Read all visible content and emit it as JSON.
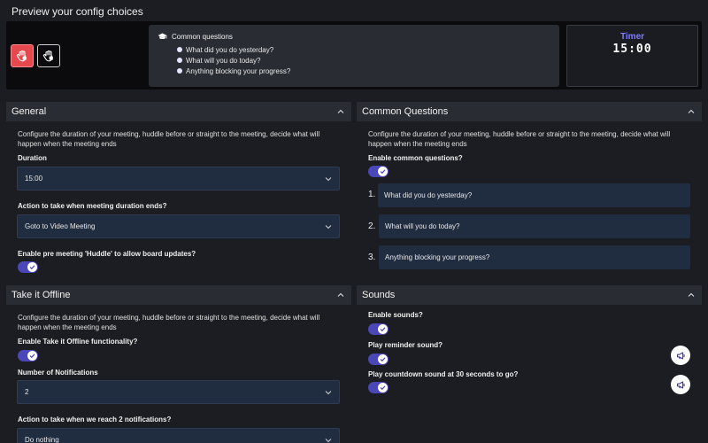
{
  "page_title": "Preview your config choices",
  "preview": {
    "common_questions_title": "Common questions",
    "questions": [
      "What did you do yesterday?",
      "What will you do today?",
      "Anything blocking your progress?"
    ],
    "timer_label": "Timer",
    "timer_value": "15:00"
  },
  "general": {
    "title": "General",
    "description": "Configure the duration of your meeting, huddle before or straight to the meeting, decide what will happen when the meeting ends",
    "duration_label": "Duration",
    "duration_value": "15:00",
    "action_label": "Action to take when meeting duration ends?",
    "action_value": "Goto to Video Meeting",
    "huddle_label": "Enable pre meeting 'Huddle' to allow board updates?",
    "huddle_enabled": true
  },
  "common_questions": {
    "title": "Common Questions",
    "description": "Configure the duration of your meeting, huddle before or straight to the meeting, decide what will happen when the meeting ends",
    "enable_label": "Enable common questions?",
    "enabled": true,
    "items": [
      {
        "num": "1.",
        "text": "What did you do yesterday?"
      },
      {
        "num": "2.",
        "text": "What will you do today?"
      },
      {
        "num": "3.",
        "text": "Anything blocking your progress?"
      }
    ]
  },
  "offline": {
    "title": "Take it Offline",
    "description": "Configure the duration of your meeting, huddle before or straight to the meeting, decide what will happen when the meeting ends",
    "enable_label": "Enable Take it Offline functionality?",
    "enabled": true,
    "notifications_label": "Number of Notifications",
    "notifications_value": "2",
    "action_label": "Action to take when we reach 2 notifications?",
    "action_value": "Do nothing"
  },
  "sounds": {
    "title": "Sounds",
    "enable_label": "Enable sounds?",
    "enabled": true,
    "reminder_label": "Play reminder sound?",
    "reminder_enabled": true,
    "countdown_label": "Play countdown sound at 30 seconds to go?",
    "countdown_enabled": true
  },
  "colors": {
    "accent": "#4b47b8",
    "danger": "#e5484d",
    "timer_label": "#7e7cff",
    "input_bg": "#202c40"
  },
  "icons": [
    "hand-icon",
    "graduation-cap-icon",
    "chevron-up-icon",
    "chevron-down-icon",
    "check-icon",
    "megaphone-icon"
  ]
}
